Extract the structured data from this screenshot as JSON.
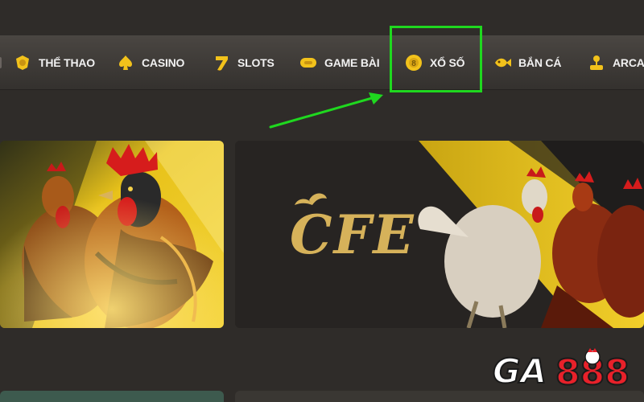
{
  "nav": {
    "items": [
      {
        "label": "THỂ THAO",
        "icon": "sports-shield-icon"
      },
      {
        "label": "CASINO",
        "icon": "spade-icon"
      },
      {
        "label": "SLOTS",
        "icon": "lucky-seven-icon"
      },
      {
        "label": "GAME BÀI",
        "icon": "game-card-icon"
      },
      {
        "label": "XỔ SỐ",
        "icon": "lottery-ball-icon"
      },
      {
        "label": "BẮN CÁ",
        "icon": "fish-icon"
      },
      {
        "label": "ARCADE",
        "icon": "joystick-icon"
      }
    ],
    "highlighted": "XỔ SỐ"
  },
  "banners": {
    "right_logo_text": "CFE"
  },
  "brand": {
    "logo_text": "GA888",
    "logo_prefix": "GA",
    "logo_suffix": "888"
  },
  "colors": {
    "icon_gold": "#f2c21b",
    "highlight_green": "#1fd81f",
    "banner_gold": "#e8c21a",
    "logo_red": "#e8212a"
  }
}
